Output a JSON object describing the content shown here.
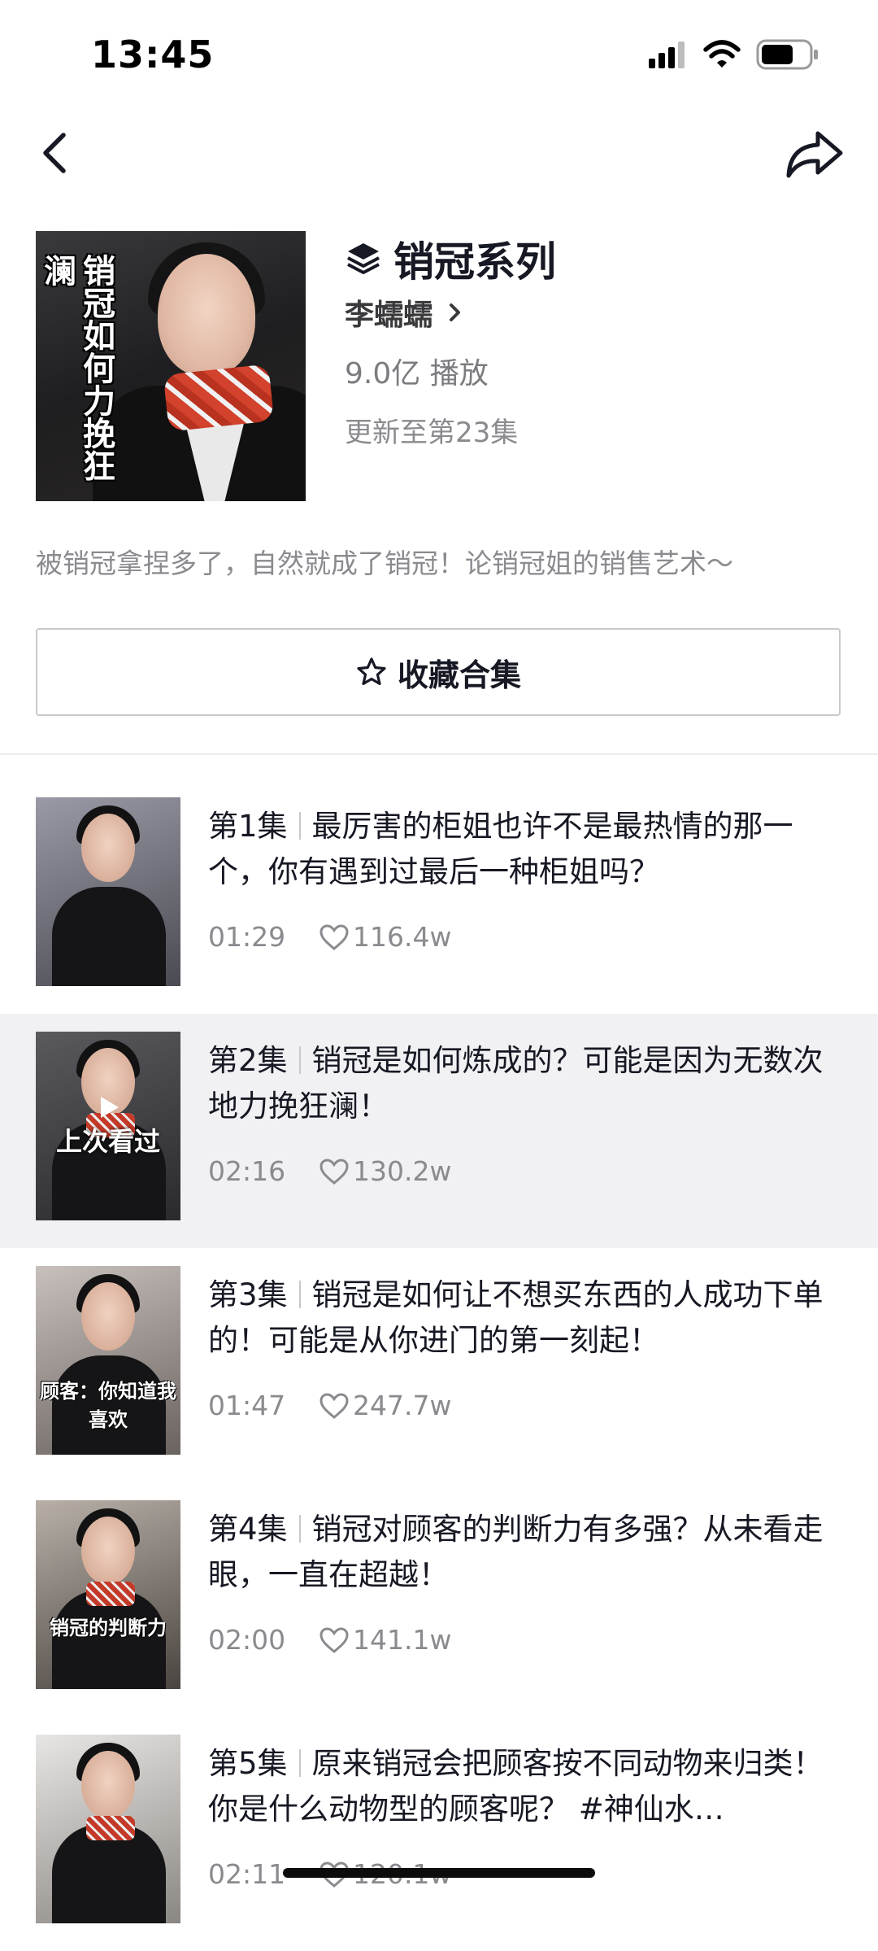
{
  "status_bar": {
    "time": "13:45"
  },
  "nav": {
    "back_icon": "chevron-left-icon",
    "share_icon": "share-arrow-icon"
  },
  "collection": {
    "cover_caption": "销冠如何力挽狂澜",
    "title_icon": "layers-icon",
    "title": "销冠系列",
    "author": "李蠕蠕",
    "plays": "9.0亿 播放",
    "updated": "更新至第23集",
    "description": "被销冠拿捏多了，自然就成了销冠！论销冠姐的销售艺术～",
    "collect_label": "收藏合集"
  },
  "episodes": [
    {
      "number": "第1集",
      "title": "最厉害的柜姐也许不是最热情的那一个，你有遇到过最后一种柜姐吗？",
      "duration": "01:29",
      "likes": "116.4w"
    },
    {
      "number": "第2集",
      "title": "销冠是如何炼成的？可能是因为无数次地力挽狂澜！",
      "duration": "02:16",
      "likes": "130.2w",
      "overlay": "上次看过",
      "highlighted": true
    },
    {
      "number": "第3集",
      "title": "销冠是如何让不想买东西的人成功下单的！可能是从你进门的第一刻起！",
      "duration": "01:47",
      "likes": "247.7w",
      "thumb_caption": "顾客：你知道我喜欢"
    },
    {
      "number": "第4集",
      "title": "销冠对顾客的判断力有多强？从未看走眼，一直在超越！",
      "duration": "02:00",
      "likes": "141.1w",
      "thumb_caption": "销冠的判断力"
    },
    {
      "number": "第5集",
      "title": "原来销冠会把顾客按不同动物来归类！你是什么动物型的顾客呢？ #神仙水…",
      "duration": "02:11",
      "likes": "120.1w"
    }
  ],
  "colors": {
    "text_primary": "#161823",
    "text_secondary": "#8a8a8f",
    "highlight_bg": "#f1f1f3",
    "divider": "#ececee"
  }
}
